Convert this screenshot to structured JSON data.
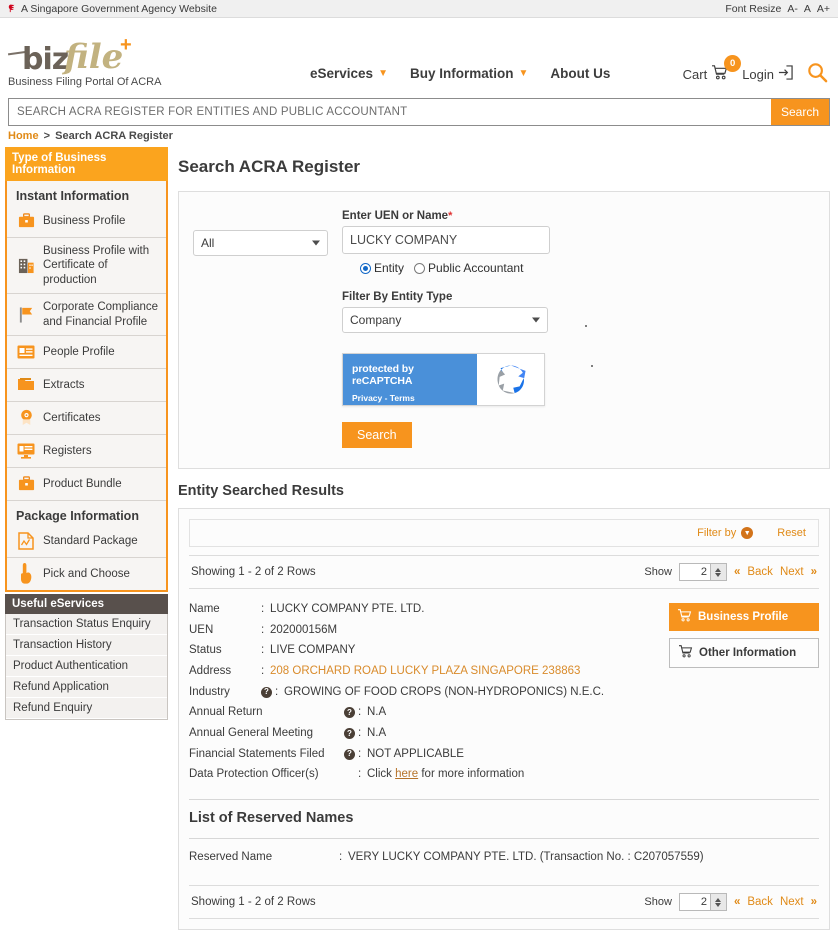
{
  "gov_bar": {
    "notice": "A Singapore Government Agency Website",
    "flag_icon": "singapore-flag-icon",
    "font_resize_label": "Font Resize",
    "font_smaller": "A-",
    "font_normal": "A",
    "font_larger": "A+"
  },
  "header": {
    "logo_biz": "biz",
    "logo_file": "file",
    "logo_plus": "+",
    "tagline": "Business Filing Portal Of ACRA",
    "nav": [
      {
        "label": "eServices",
        "has_dropdown": true
      },
      {
        "label": "Buy Information",
        "has_dropdown": true
      },
      {
        "label": "About Us",
        "has_dropdown": false
      }
    ],
    "cart_label": "Cart",
    "cart_count": "0",
    "login_label": "Login",
    "search_icon": "magnifier-icon"
  },
  "global_search": {
    "placeholder": "SEARCH ACRA REGISTER FOR ENTITIES AND PUBLIC ACCOUNTANT",
    "value": "",
    "button_label": "Search"
  },
  "breadcrumb": {
    "home": "Home",
    "separator": ">",
    "current": "Search ACRA Register"
  },
  "sidebar": {
    "panel_title": "Type of Business Information",
    "group_instant": "Instant Information",
    "instant_items": [
      {
        "label": "Business Profile",
        "icon": "briefcase-icon"
      },
      {
        "label": "Business Profile with Certificate of production",
        "icon": "building-icon"
      },
      {
        "label": "Corporate Compliance and Financial Profile",
        "icon": "flag-icon"
      },
      {
        "label": "People Profile",
        "icon": "id-card-icon"
      },
      {
        "label": "Extracts",
        "icon": "folder-icon"
      },
      {
        "label": "Certificates",
        "icon": "eye-seal-icon"
      },
      {
        "label": "Registers",
        "icon": "monitor-icon"
      },
      {
        "label": "Product Bundle",
        "icon": "briefcase-icon"
      }
    ],
    "group_package": "Package Information",
    "package_items": [
      {
        "label": "Standard Package",
        "icon": "document-chart-icon"
      },
      {
        "label": "Pick and Choose",
        "icon": "pointing-hand-icon"
      }
    ],
    "eservices_title": "Useful eServices",
    "eservices_items": [
      "Transaction Status Enquiry",
      "Transaction History",
      "Product Authentication",
      "Refund Application",
      "Refund Enquiry"
    ]
  },
  "main": {
    "page_title": "Search ACRA Register",
    "form": {
      "type_select_value": "All",
      "uen_label": "Enter UEN or Name",
      "required_mark": "*",
      "uen_value": "LUCKY COMPANY",
      "uen_placeholder": "",
      "radio_entity": "Entity",
      "radio_public_accountant": "Public Accountant",
      "radio_selected": "Entity",
      "filter_label": "Filter By Entity Type",
      "filter_value": "Company",
      "recaptcha_line1": "protected by reCAPTCHA",
      "recaptcha_line2": "Privacy - Terms",
      "search_button": "Search"
    },
    "results_title": "Entity Searched Results",
    "filter_by_label": "Filter by",
    "reset_label": "Reset",
    "pager_top": {
      "showing": "Showing 1 - 2 of 2 Rows",
      "show_label": "Show",
      "show_value": "2",
      "first_label": "«",
      "back_label": "Back",
      "next_label": "Next",
      "last_label": "»"
    },
    "entity": {
      "rows": [
        {
          "key": "Name",
          "value": "LUCKY COMPANY PTE. LTD.",
          "orange": false,
          "help": false
        },
        {
          "key": "UEN",
          "value": "202000156M",
          "orange": false,
          "help": false
        },
        {
          "key": "Status",
          "value": "LIVE COMPANY",
          "orange": false,
          "help": false
        },
        {
          "key": "Address",
          "value": "208 ORCHARD ROAD LUCKY PLAZA SINGAPORE 238863",
          "orange": true,
          "help": false
        },
        {
          "key": "Industry",
          "value": "GROWING OF FOOD CROPS (NON-HYDROPONICS) N.E.C.",
          "orange": false,
          "help": true
        }
      ],
      "rows_wide": [
        {
          "key": "Annual Return",
          "value": "N.A",
          "help": true
        },
        {
          "key": "Annual General Meeting",
          "value": "N.A",
          "help": true
        },
        {
          "key": "Financial Statements Filed",
          "value": "NOT APPLICABLE",
          "help": true
        }
      ],
      "dpo_key": "Data Protection Officer(s)",
      "dpo_prefix": "Click",
      "dpo_link": "here",
      "dpo_suffix": "for more information",
      "btn_business_profile": "Business Profile",
      "btn_other_information": "Other Information"
    },
    "reserved": {
      "title": "List of Reserved Names",
      "key": "Reserved Name",
      "value": "VERY LUCKY COMPANY PTE. LTD. (Transaction No. : C207057559)"
    },
    "pager_bottom": {
      "showing": "Showing 1 - 2 of 2 Rows",
      "show_label": "Show",
      "show_value": "2",
      "first_label": "«",
      "back_label": "Back",
      "next_label": "Next",
      "last_label": "»"
    }
  },
  "colors": {
    "brand_orange": "#f7941e",
    "sidebar_header_orange": "#fba41e",
    "dark_header": "#58504c",
    "link_orange": "#e08a17",
    "recaptcha_blue": "#4a90d9"
  }
}
